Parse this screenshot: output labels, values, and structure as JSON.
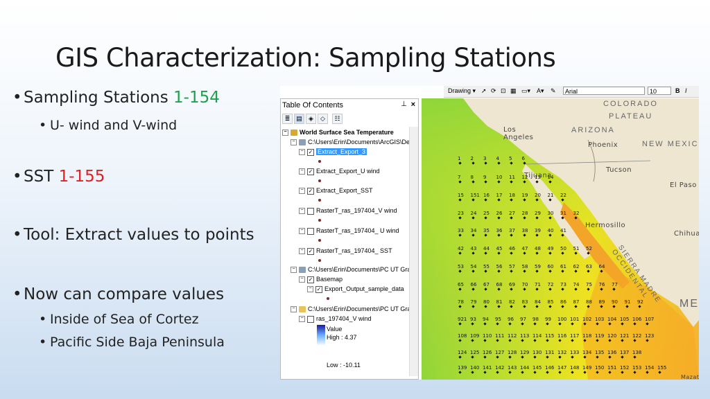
{
  "slide": {
    "title": "GIS Characterization: Sampling Stations",
    "bullets": [
      {
        "text": "Sampling Stations ",
        "highlight": "1-154",
        "highlight_color": "#1aa34a",
        "sub": [
          "U- wind and V-wind"
        ]
      },
      {
        "text": "SST ",
        "highlight": "1-155",
        "highlight_color": "#e02020",
        "sub": []
      },
      {
        "text": "Tool: Extract values to points",
        "highlight": "",
        "sub": []
      },
      {
        "text": "Now can compare values",
        "highlight": "",
        "sub": [
          "Inside of Sea of Cortez",
          "Pacific Side Baja Peninsula"
        ]
      }
    ]
  },
  "toolbar": {
    "drawing_label": "Drawing ▾",
    "font_name": "Arial",
    "font_size": "10",
    "bold": "B",
    "italic": "I"
  },
  "toc": {
    "title": "Table Of Contents",
    "pin": "↕",
    "close": "✖",
    "items": [
      {
        "label": "World Surface Sea Temperature",
        "bold": true
      },
      {
        "label": "C:\\Users\\Erin\\Documents\\ArcGIS\\De"
      },
      {
        "label": "Extract_Export_3",
        "selected": true,
        "checked": true
      },
      {
        "label": "Extract_Export_U wind",
        "checked": true
      },
      {
        "label": "Extract_Export_SST",
        "checked": true
      },
      {
        "label": "RasterT_ras_197404_V wind",
        "checked": false
      },
      {
        "label": "RasterT_ras_197404_ U wind",
        "checked": false
      },
      {
        "label": "RasterT_ras_197404_ SST",
        "checked": true
      },
      {
        "label": "C:\\Users\\Erin\\Documents\\PC UT Gra"
      },
      {
        "label": "Basemap",
        "checked": true
      },
      {
        "label": "Export_Output_sample_data",
        "checked": true
      },
      {
        "label": "C:\\Users\\Erin\\Documents\\PC UT Gra"
      },
      {
        "label": "ras_197404_V wind",
        "checked": false
      }
    ],
    "legend": {
      "value_label": "Value",
      "high": "High : 4.37",
      "low": "Low : -10.11"
    }
  },
  "map": {
    "places": [
      "COLORADO",
      "PLATEAU",
      "Los Angeles",
      "ARIZONA",
      "Phoenix",
      "NEW MEXIC",
      "Tijuana",
      "Tucson",
      "El Paso",
      "Hermosillo",
      "Chihuah",
      "SIERRA MADRE OCCIDENTAL",
      "ME",
      "Mazatl"
    ],
    "station_rows": [
      [
        "1",
        "2",
        "3",
        "4",
        "5",
        "6"
      ],
      [
        "7",
        "8",
        "9",
        "10",
        "11",
        "12",
        "13",
        "14"
      ],
      [
        "15",
        "151",
        "16",
        "17",
        "18",
        "19",
        "20",
        "21",
        "22"
      ],
      [
        "23",
        "24",
        "25",
        "26",
        "27",
        "28",
        "29",
        "30",
        "31",
        "32"
      ],
      [
        "33",
        "34",
        "35",
        "36",
        "37",
        "38",
        "39",
        "40",
        "41"
      ],
      [
        "42",
        "43",
        "44",
        "45",
        "46",
        "47",
        "48",
        "49",
        "50",
        "51",
        "52"
      ],
      [
        "53",
        "54",
        "55",
        "56",
        "57",
        "58",
        "59",
        "60",
        "61",
        "62",
        "63",
        "64"
      ],
      [
        "65",
        "66",
        "67",
        "68",
        "69",
        "70",
        "71",
        "72",
        "73",
        "74",
        "75",
        "76",
        "77"
      ],
      [
        "78",
        "79",
        "80",
        "81",
        "82",
        "83",
        "84",
        "85",
        "86",
        "87",
        "88",
        "89",
        "90",
        "91",
        "92"
      ],
      [
        "921",
        "93",
        "94",
        "95",
        "96",
        "97",
        "98",
        "99",
        "100",
        "101",
        "102",
        "103",
        "104",
        "105",
        "106",
        "107"
      ],
      [
        "108",
        "109",
        "110",
        "111",
        "112",
        "113",
        "114",
        "115",
        "116",
        "117",
        "118",
        "119",
        "120",
        "121",
        "122",
        "123"
      ],
      [
        "124",
        "125",
        "126",
        "127",
        "128",
        "129",
        "130",
        "131",
        "132",
        "133",
        "134",
        "135",
        "136",
        "137",
        "138"
      ],
      [
        "139",
        "140",
        "141",
        "142",
        "143",
        "144",
        "145",
        "146",
        "147",
        "148",
        "149",
        "150",
        "151",
        "152",
        "153",
        "154",
        "155"
      ]
    ],
    "colors": {
      "warm": "#f5a623",
      "yellow": "#f4e81c",
      "green": "#8dd43a",
      "land": "#efe6d2"
    }
  }
}
